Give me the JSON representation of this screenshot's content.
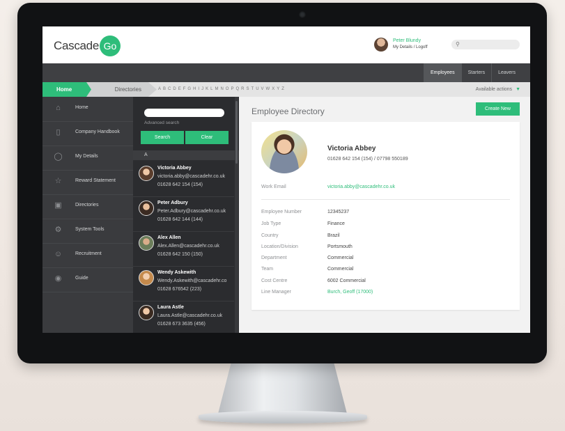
{
  "app": {
    "logo_text": "Cascade",
    "logo_badge": "Go",
    "user_name": "Peter Blundy",
    "user_links": [
      "My Details",
      "/",
      "Logoff"
    ]
  },
  "nav": {
    "tabs": [
      {
        "label": "Employees",
        "active": true
      },
      {
        "label": "Starters",
        "active": false
      },
      {
        "label": "Leavers",
        "active": false
      }
    ]
  },
  "breadcrumb": {
    "home": "Home",
    "directories": "Directories",
    "alphabet": [
      "A",
      "B",
      "C",
      "D",
      "E",
      "F",
      "G",
      "H",
      "I",
      "J",
      "K",
      "L",
      "M",
      "N",
      "O",
      "P",
      "Q",
      "R",
      "S",
      "T",
      "U",
      "V",
      "W",
      "X",
      "Y",
      "Z"
    ],
    "available_actions": "Available actions"
  },
  "sidebar": {
    "items": [
      {
        "label": "Home",
        "icon": "house-icon"
      },
      {
        "label": "Company Handbook",
        "icon": "book-icon"
      },
      {
        "label": "My Details",
        "icon": "user-icon"
      },
      {
        "label": "Reward Statement",
        "icon": "star-icon"
      },
      {
        "label": "Directories",
        "icon": "directory-icon"
      },
      {
        "label": "System Tools",
        "icon": "wrench-icon"
      },
      {
        "label": "Recruitment",
        "icon": "users-icon"
      },
      {
        "label": "Guide",
        "icon": "guide-icon"
      }
    ]
  },
  "directory": {
    "search_value": "",
    "advanced_search": "Advanced search",
    "search_button": "Search",
    "clear_button": "Clear",
    "letter": "A",
    "contacts": [
      {
        "name": "Victoria Abbey",
        "email": "victoria.abby@cascadehr.co.uk",
        "phone": "01628 642 154 (154)"
      },
      {
        "name": "Peter Adbury",
        "email": "Peter.Adbury@cascadehr.co.uk",
        "phone": "01628 642 144 (144)"
      },
      {
        "name": "Alex Allen",
        "email": "Alex.Allen@cascadehr.co.uk",
        "phone": "01628 642 150 (150)"
      },
      {
        "name": "Wendy Askewith",
        "email": "Wendy.Askewith@cascadehr.co",
        "phone": "01628 676542 (223)"
      },
      {
        "name": "Laura Astle",
        "email": "Laura.Astle@cascadehr.co.uk",
        "phone": "01628 673 3635 (456)"
      }
    ]
  },
  "main": {
    "title": "Employee Directory",
    "create_button": "Create New",
    "employee": {
      "name": "Victoria Abbey",
      "phone": "01628 642 154 (154) / 07798 550189",
      "work_email_label": "Work Email",
      "work_email": "victoria.abby@cascadehr.co.uk",
      "fields": [
        {
          "label": "Employee Number",
          "value": "12345237"
        },
        {
          "label": "Job Type",
          "value": "Finance"
        },
        {
          "label": "Country",
          "value": "Brazil"
        },
        {
          "label": "Location/Division",
          "value": "Portsmouth"
        },
        {
          "label": "Department",
          "value": "Commercial"
        },
        {
          "label": "Team",
          "value": "Commercial"
        },
        {
          "label": "Cost Centre",
          "value": "6002 Commercial"
        },
        {
          "label": "Line Manager",
          "value": "Burch, Geoff (17000)"
        }
      ]
    }
  },
  "colors": {
    "accent": "#2ebd7a",
    "sidebar": "#3a3b3e",
    "directory_panel": "#2b2c2f",
    "navbar": "#3f4043"
  }
}
